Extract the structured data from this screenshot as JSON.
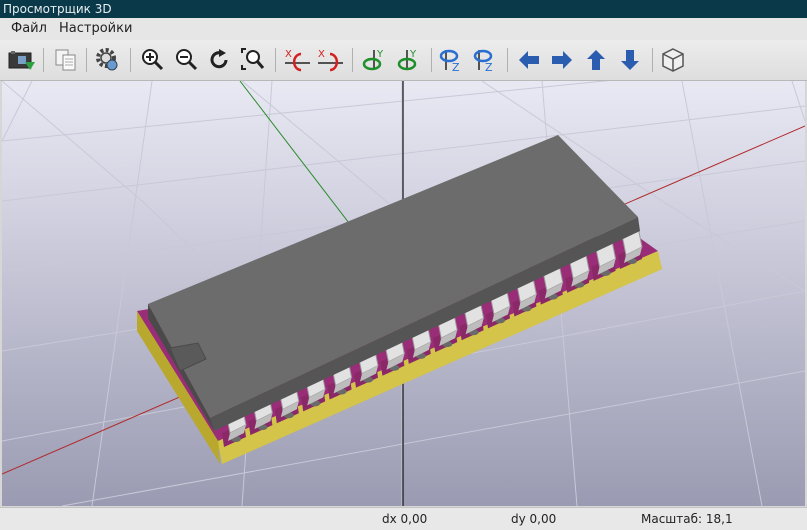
{
  "window": {
    "title": "Просмотрщик 3D"
  },
  "menu": {
    "file": "Файл",
    "settings": "Настройки"
  },
  "toolbar": {
    "buttons": [
      "export-image-icon",
      "copy-icon",
      "settings-icon",
      "zoom-in-icon",
      "zoom-out-icon",
      "redraw-icon",
      "zoom-fit-icon",
      "rotate-x-cw-icon",
      "rotate-x-ccw-icon",
      "rotate-y-cw-icon",
      "rotate-y-ccw-icon",
      "rotate-z-cw-icon",
      "rotate-z-ccw-icon",
      "move-left-icon",
      "move-right-icon",
      "move-up-icon",
      "move-down-icon",
      "ortho-view-icon"
    ],
    "axis_labels": {
      "x": "X",
      "y": "Y",
      "z": "Z"
    },
    "colors": {
      "arrow": "#2a5db0",
      "rotate_red": "#d42020",
      "rotate_green": "#1f8f2a",
      "rotate_blue": "#2a6fd0"
    }
  },
  "status": {
    "dx": "dx 0,00",
    "dy": "dy 0,00",
    "scale": "Масштаб: 18,1"
  },
  "scene": {
    "background_top": "#e9e9f4",
    "background_bottom": "#9a9ab2",
    "body_color": "#6a6a6a",
    "pcb_color": "#9a2d78",
    "pad_color": "#c8b832",
    "pin_color": "#e2e2e2"
  }
}
